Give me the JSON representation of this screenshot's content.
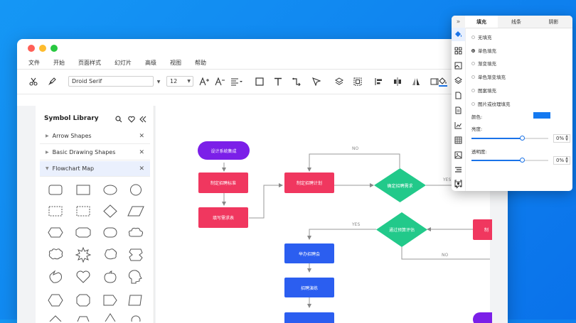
{
  "menu": [
    "文件",
    "开始",
    "页面样式",
    "幻灯片",
    "高级",
    "视图",
    "帮助"
  ],
  "toolbar": {
    "font_name": "Droid Serif",
    "font_size": "12"
  },
  "sidebar": {
    "title": "Symbol Library",
    "items": [
      {
        "label": "Arrow Shapes"
      },
      {
        "label": "Basic Drawing Shapes"
      },
      {
        "label": "Flowchart Map"
      }
    ]
  },
  "flow": {
    "start": "设计系统集成",
    "n1": "制定招聘标准",
    "n2": "填写需求表",
    "n3": "制定招聘计划",
    "d1": "确定招聘需求",
    "d2": "通过预算评估",
    "n4": "举办招聘会",
    "n5": "招聘演练",
    "n6": "制",
    "yes": "YES",
    "no": "NO"
  },
  "panel": {
    "tabs": [
      "填充",
      "线条",
      "阴影"
    ],
    "fill_options": [
      "无填充",
      "单色填充",
      "渐变填充",
      "单色渐变填充",
      "图案填充",
      "图片或纹理填充"
    ],
    "selected_fill": "单色填充",
    "color_label": "颜色:",
    "color_value": "#1479f0",
    "brightness_label": "亮度:",
    "brightness_value": "0%",
    "transparency_label": "透明度:",
    "transparency_value": "0%"
  },
  "colors": {
    "accent": "#1a73e8",
    "start": "#7b1fe8",
    "process_red": "#f0375f",
    "decision": "#22c98a",
    "process_blue": "#2b5ef0"
  }
}
